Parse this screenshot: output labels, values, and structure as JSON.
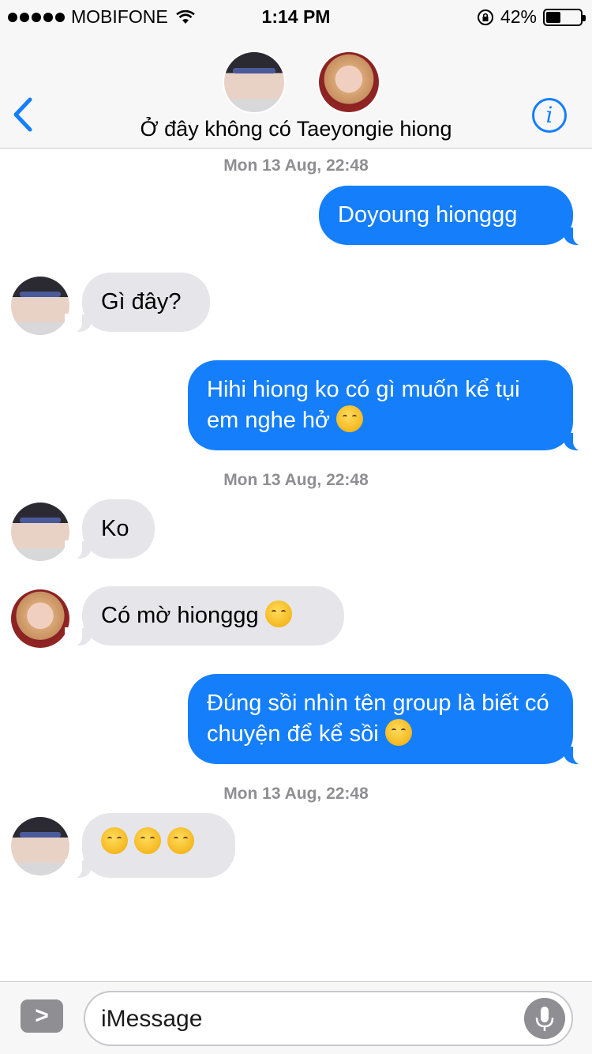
{
  "status_bar": {
    "carrier": "MOBIFONE",
    "time": "1:14 PM",
    "battery_percent": "42%",
    "battery_level": 0.42
  },
  "header": {
    "group_name": "Ở đây không có Taeyongie hiong",
    "back_icon": "chevron-left-icon",
    "info_icon": "info-icon",
    "info_label": "i"
  },
  "messages": [
    {
      "type": "timestamp",
      "text": "Mon 13 Aug, 22:48"
    },
    {
      "type": "outgoing",
      "text": "Doyoung hionggg"
    },
    {
      "type": "incoming",
      "sender": "a",
      "text": "Gì đây?"
    },
    {
      "type": "outgoing",
      "text": "Hihi hiong ko có gì muốn kể tụi em nghe hở"
    },
    {
      "type": "timestamp",
      "text": "Mon 13 Aug, 22:48"
    },
    {
      "type": "incoming",
      "sender": "a",
      "text": "Ko"
    },
    {
      "type": "incoming",
      "sender": "b",
      "text": "Có mờ hionggg"
    },
    {
      "type": "outgoing",
      "text": "Đúng sồi nhìn tên group là biết có chuyện để kể sồi"
    },
    {
      "type": "timestamp",
      "text": "Mon 13 Aug, 22:48"
    },
    {
      "type": "incoming",
      "sender": "a",
      "text": ""
    }
  ],
  "input": {
    "placeholder": "iMessage",
    "apps_label": ">"
  },
  "colors": {
    "outgoing_bubble": "#157efb",
    "incoming_bubble": "#e5e5ea",
    "accent": "#157efb"
  }
}
